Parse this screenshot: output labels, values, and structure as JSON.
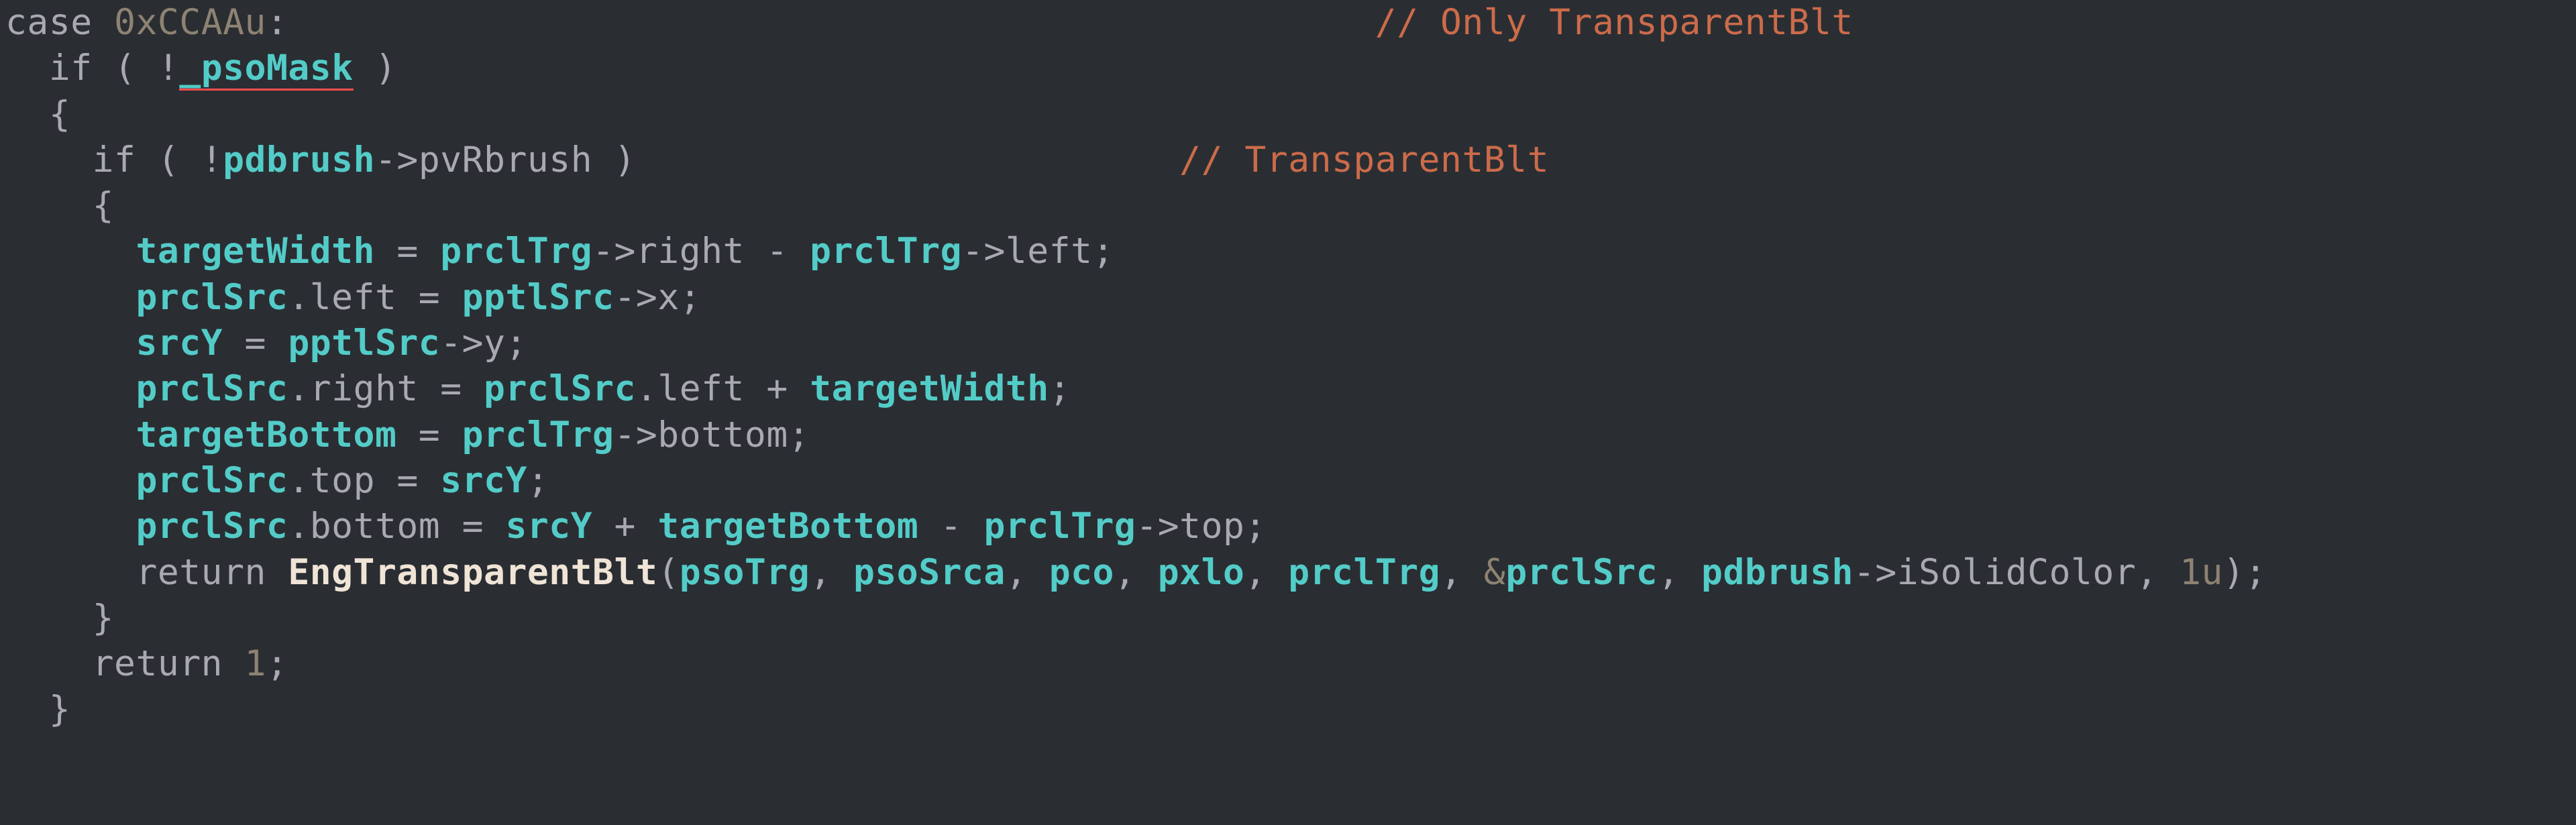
{
  "code": {
    "l1": {
      "kw_case": "case",
      "hex": "0xCCAAu",
      "colon": ":",
      "comment": "// Only TransparentBlt"
    },
    "l2": {
      "kw_if": "if",
      "pso": "_psoMask",
      "bang": "!",
      "op": "(",
      "cp": ")"
    },
    "l3": {
      "brace": "{"
    },
    "l4": {
      "kw_if": "if",
      "bang": "!",
      "pdbrush": "pdbrush",
      "arrow": "->",
      "member": "pvRbrush",
      "comment": "// TransparentBlt"
    },
    "l5": {
      "brace": "{"
    },
    "l6": {
      "lhs": "targetWidth",
      "eq": " = ",
      "a": "prclTrg",
      "ar1": "->",
      "m1": "right",
      "minus": " - ",
      "b": "prclTrg",
      "ar2": "->",
      "m2": "left",
      "semi": ";"
    },
    "l7": {
      "a": "prclSrc",
      "dot": ".",
      "m": "left",
      "eq": " = ",
      "b": "pptlSrc",
      "ar": "->",
      "m2": "x",
      "semi": ";"
    },
    "l8": {
      "a": "srcY",
      "eq": " = ",
      "b": "pptlSrc",
      "ar": "->",
      "m": "y",
      "semi": ";"
    },
    "l9": {
      "a": "prclSrc",
      "dot": ".",
      "m": "right",
      "eq": " = ",
      "b": "prclSrc",
      "dot2": ".",
      "m2": "left",
      "plus": " + ",
      "c": "targetWidth",
      "semi": ";"
    },
    "l10": {
      "a": "targetBottom",
      "eq": " = ",
      "b": "prclTrg",
      "ar": "->",
      "m": "bottom",
      "semi": ";"
    },
    "l11": {
      "a": "prclSrc",
      "dot": ".",
      "m": "top",
      "eq": " = ",
      "b": "srcY",
      "semi": ";"
    },
    "l12": {
      "a": "prclSrc",
      "dot": ".",
      "m": "bottom",
      "eq": " = ",
      "b": "srcY",
      "plus": " + ",
      "c": "targetBottom",
      "minus": " - ",
      "d": "prclTrg",
      "ar": "->",
      "m2": "top",
      "semi": ";"
    },
    "l13": {
      "kw_ret": "return",
      "fn": "EngTransparentBlt",
      "a1": "psoTrg",
      "a2": "psoSrca",
      "a3": "pco",
      "a4": "pxlo",
      "a5": "prclTrg",
      "amp": "&",
      "a6": "prclSrc",
      "a7": "pdbrush",
      "ar": "->",
      "m": "iSolidColor",
      "a8": "1u",
      "op": "(",
      "cp": ")",
      "semi": ";",
      "comma": ", "
    },
    "l14": {
      "brace": "}"
    },
    "l15": {
      "kw_ret": "return",
      "val": "1",
      "semi": ";"
    },
    "l16": {
      "brace": "}"
    }
  }
}
